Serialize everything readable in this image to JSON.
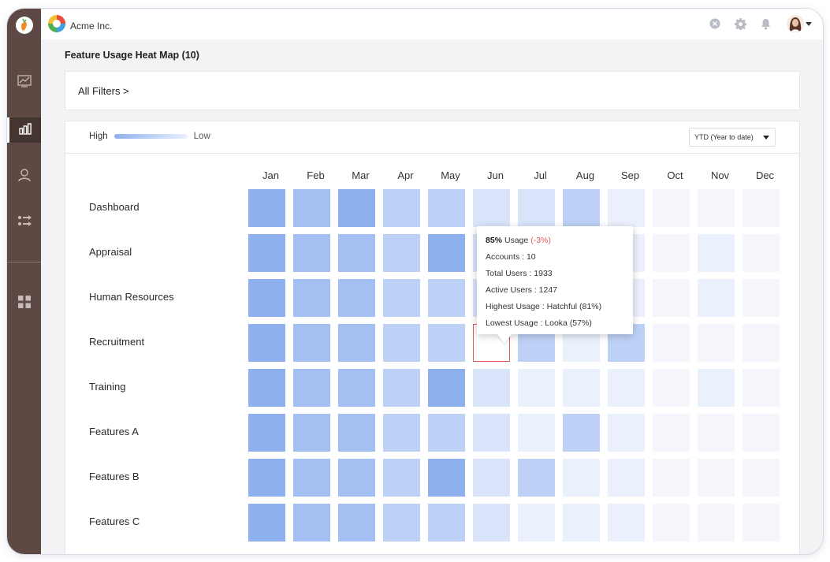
{
  "app": {
    "company_name": "Acme Inc.",
    "page_title": "Feature Usage Heat Map (10)",
    "filters_label": "All Filters >"
  },
  "sidebar": {
    "items": [
      {
        "icon": "line-chart-icon",
        "active": false
      },
      {
        "icon": "bar-chart-icon",
        "active": true
      },
      {
        "icon": "user-icon",
        "active": false
      },
      {
        "icon": "transfer-icon",
        "active": false
      },
      {
        "icon": "apps-grid-icon",
        "active": false
      }
    ]
  },
  "topbar": {
    "icons": [
      "close-circle-icon",
      "gear-icon",
      "bell-icon",
      "avatar",
      "chevron-down-icon"
    ]
  },
  "legend": {
    "high": "High",
    "low": "Low"
  },
  "period_select": {
    "value": "YTD (Year to date)"
  },
  "colors": {
    "level_5": "#8fb0ef",
    "level_4": "#a4c0f2",
    "level_3": "#bdd1f6",
    "level_2": "#d9e4fa",
    "level_1": "#eaf0fc",
    "level_0": "#f4f6fb",
    "selected_border": "#e05b5b",
    "sidebar": "#5d4843"
  },
  "chart_data": {
    "type": "heatmap",
    "columns": [
      "Jan",
      "Feb",
      "Mar",
      "Apr",
      "May",
      "Jun",
      "Jul",
      "Aug",
      "Sep",
      "Oct",
      "Nov",
      "Dec"
    ],
    "rows": [
      "Dashboard",
      "Appraisal",
      "Human Resources",
      "Recruitment",
      "Training",
      "Features A",
      "Features B",
      "Features C"
    ],
    "levels": [
      [
        5,
        4,
        5,
        3,
        3,
        2,
        2,
        3,
        1,
        0,
        0,
        0
      ],
      [
        5,
        4,
        4,
        3,
        5,
        2,
        2,
        1,
        1,
        0,
        1,
        0
      ],
      [
        5,
        4,
        4,
        3,
        3,
        2,
        2,
        1,
        1,
        0,
        1,
        0
      ],
      [
        5,
        4,
        4,
        3,
        3,
        2,
        3,
        1,
        3,
        0,
        0,
        0
      ],
      [
        5,
        4,
        4,
        3,
        5,
        2,
        1,
        1,
        1,
        0,
        1,
        0
      ],
      [
        5,
        4,
        4,
        3,
        3,
        2,
        1,
        3,
        1,
        0,
        0,
        0
      ],
      [
        5,
        4,
        4,
        3,
        5,
        2,
        3,
        1,
        1,
        0,
        0,
        0
      ],
      [
        5,
        4,
        4,
        3,
        3,
        2,
        1,
        1,
        1,
        0,
        0,
        0
      ]
    ],
    "selected": {
      "row": "Recruitment",
      "column": "Jun"
    }
  },
  "tooltip": {
    "usage_value": "85%",
    "usage_label": "Usage",
    "usage_delta": "(-3%)",
    "lines": [
      "Accounts : 10",
      "Total Users :  1933",
      "Active Users :  1247",
      "Highest Usage : Hatchful (81%)",
      "Lowest Usage : Looka (57%)"
    ]
  }
}
